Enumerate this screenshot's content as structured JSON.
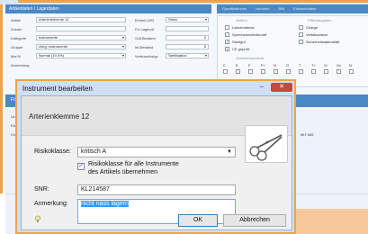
{
  "bg_window": {
    "tab_title": "Artikeldaten / Lagerdaten",
    "tabs_right": [
      "Spezifikationen",
      "Inkonten",
      "Bild",
      "Einkaufsdaten"
    ],
    "fields": [
      {
        "label": "Artikel",
        "value": "Arterienklemme 12"
      },
      {
        "label": "Zusatz",
        "value": ""
      },
      {
        "label": "Kategorie",
        "value": "Instrumente"
      },
      {
        "label": "Gruppe",
        "value": "chirg. Instrumente"
      },
      {
        "label": "Mw.St",
        "value": "Normal (19.0%)"
      },
      {
        "label": "Anmerkung",
        "value": ""
      }
    ],
    "fields_right": [
      {
        "label": "Einheit (VE)",
        "value": "Stück"
      },
      {
        "label": "Fix Lagerort",
        "value": ""
      },
      {
        "label": "Soll-Bestand",
        "value": "0"
      },
      {
        "label": "Ist-Bestand",
        "value": "5"
      },
      {
        "label": "Verbrauchstyp",
        "value": "Sterilisation"
      }
    ],
    "attribut_title": "Attribut",
    "attributes": [
      {
        "label": "Labormaterial",
        "checked": false
      },
      {
        "label": "Sprechstundenbedarf",
        "checked": false
      },
      {
        "label": "Sterilgut",
        "checked": true
      },
      {
        "label": "CE geprüft",
        "checked": true
      }
    ],
    "pflicht_title": "Pflichtangaben",
    "pflicht": [
      {
        "label": "Charge",
        "checked": false
      },
      {
        "label": "Verfallsdatum",
        "checked": false
      },
      {
        "label": "Sicherheitsdatenblatt",
        "checked": false
      }
    ],
    "gefahr_title": "Gefahrensymbole",
    "gefahr_symbols": [
      "C",
      "E",
      "F",
      "F+",
      "N",
      "O",
      "T",
      "T+",
      "Xi",
      "Xn",
      "N"
    ],
    "band_left": "Fö",
    "lower_rows": [
      "La",
      "Fa",
      "Ch"
    ],
    "lower_value": "067.905"
  },
  "dialog": {
    "title": "Instrument bearbeiten",
    "minimize": "–",
    "close": "✕",
    "device_name": "Arterienklemme 12",
    "risk_label": "Risikoklasse:",
    "risk_value": "kritisch A",
    "risk_all_line1": "Risikoklasse für alle Instrumente",
    "risk_all_line2": "des Artikels übernehmen",
    "risk_all_checked": true,
    "snr_label": "SNR:",
    "snr_value": "KL214587",
    "note_label": "Anmerkung:",
    "note_value": "nicht nass lagern",
    "ok_label": "OK",
    "cancel_label": "Abbrechen",
    "info_icon": "bulb-icon"
  }
}
